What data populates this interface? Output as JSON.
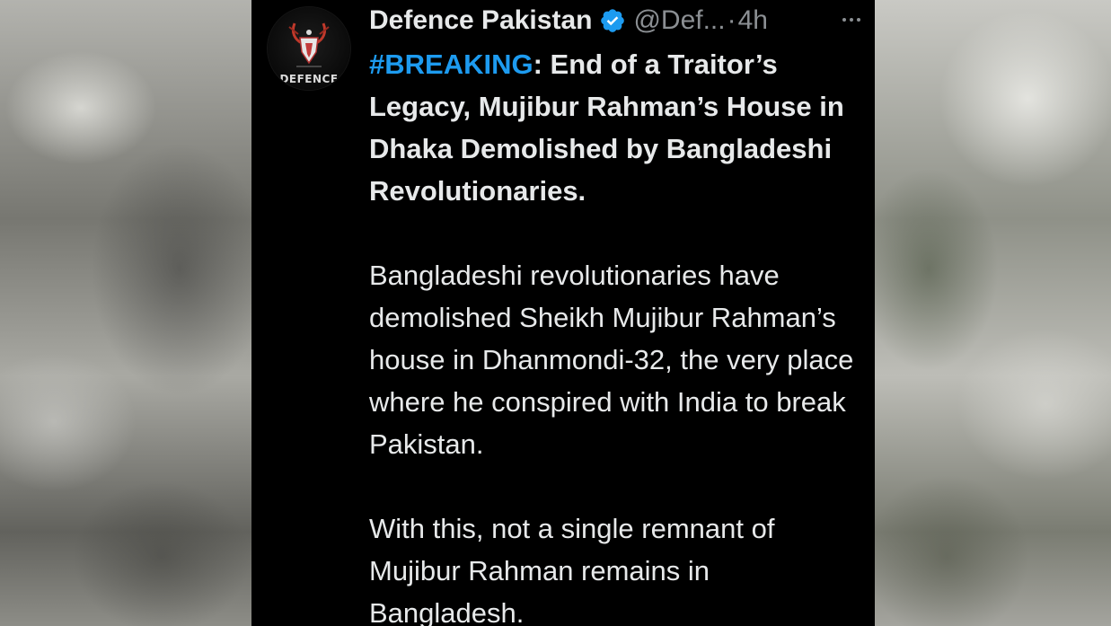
{
  "tweet": {
    "author": {
      "display_name": "Defence Pakistan",
      "handle": "@Def...",
      "verified": true,
      "avatar_logo_text": "DEFENCE"
    },
    "separator": "·",
    "timestamp": "4h",
    "hashtag": "#BREAKING",
    "headline": ": End of a Traitor’s Legacy, Mujibur Rahman’s House in Dhaka Demolished by Bangladeshi Revolutionaries.",
    "paragraph_1": "Bangladeshi revolutionaries have demolished Sheikh Mujibur Rahman’s house in Dhanmondi-32, the very place where he conspired with India to break Pakistan.",
    "paragraph_2": "With this, not a single remnant of Mujibur Rahman remains in Bangladesh."
  },
  "icons": {
    "verified": "verified-badge-icon",
    "more": "more-options-icon"
  },
  "colors": {
    "background": "#000000",
    "text": "#e7e9ea",
    "muted": "#8b8f93",
    "accent": "#1d9bf0"
  }
}
